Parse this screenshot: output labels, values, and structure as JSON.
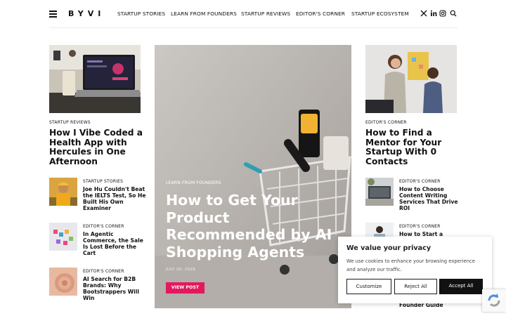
{
  "header": {
    "logo": "BYVI",
    "nav": [
      "STARTUP STORIES",
      "LEARN FROM FOUNDERS",
      "STARTUP REVIEWS",
      "EDITOR'S CORNER",
      "STARTUP ECOSYSTEM"
    ],
    "icons": [
      "menu-icon",
      "x-icon",
      "linkedin-icon",
      "instagram-icon",
      "search-icon"
    ]
  },
  "left": {
    "feature": {
      "category": "STARTUP REVIEWS",
      "title": "How I Vibe Coded a Health App with Hercules in One Afternoon"
    },
    "items": [
      {
        "category": "STARTUP STORIES",
        "title": "Joe Hu Couldn't Beat the IELTS Test, So He Built His Own Examiner"
      },
      {
        "category": "EDITOR'S CORNER",
        "title": "In Agentic Commerce, the Sale Is Lost Before the Cart"
      },
      {
        "category": "EDITOR'S CORNER",
        "title": "AI Search for B2B Brands: Why Bootstrappers Will Win"
      }
    ]
  },
  "hero": {
    "category": "LEARN FROM FOUNDERS",
    "title": "How to Get Your Product Recommended by AI Shopping Agents",
    "date": "JULY 30, 2026",
    "button": "VIEW POST"
  },
  "right": {
    "feature": {
      "category": "EDITOR'S CORNER",
      "title": "How to Find a Mentor for Your Startup With 0 Contacts"
    },
    "items": [
      {
        "category": "EDITOR'S CORNER",
        "title": "How to Choose Content Writing Services That Drive ROI"
      },
      {
        "category": "EDITOR'S CORNER",
        "title": "How to Start a"
      }
    ],
    "partial_title": "Founder Guide"
  },
  "cookie": {
    "title": "We value your privacy",
    "text": "We use cookies to enhance your browsing experience and analyze our traffic.",
    "customize": "Customize",
    "reject": "Reject All",
    "accept": "Accept All"
  }
}
